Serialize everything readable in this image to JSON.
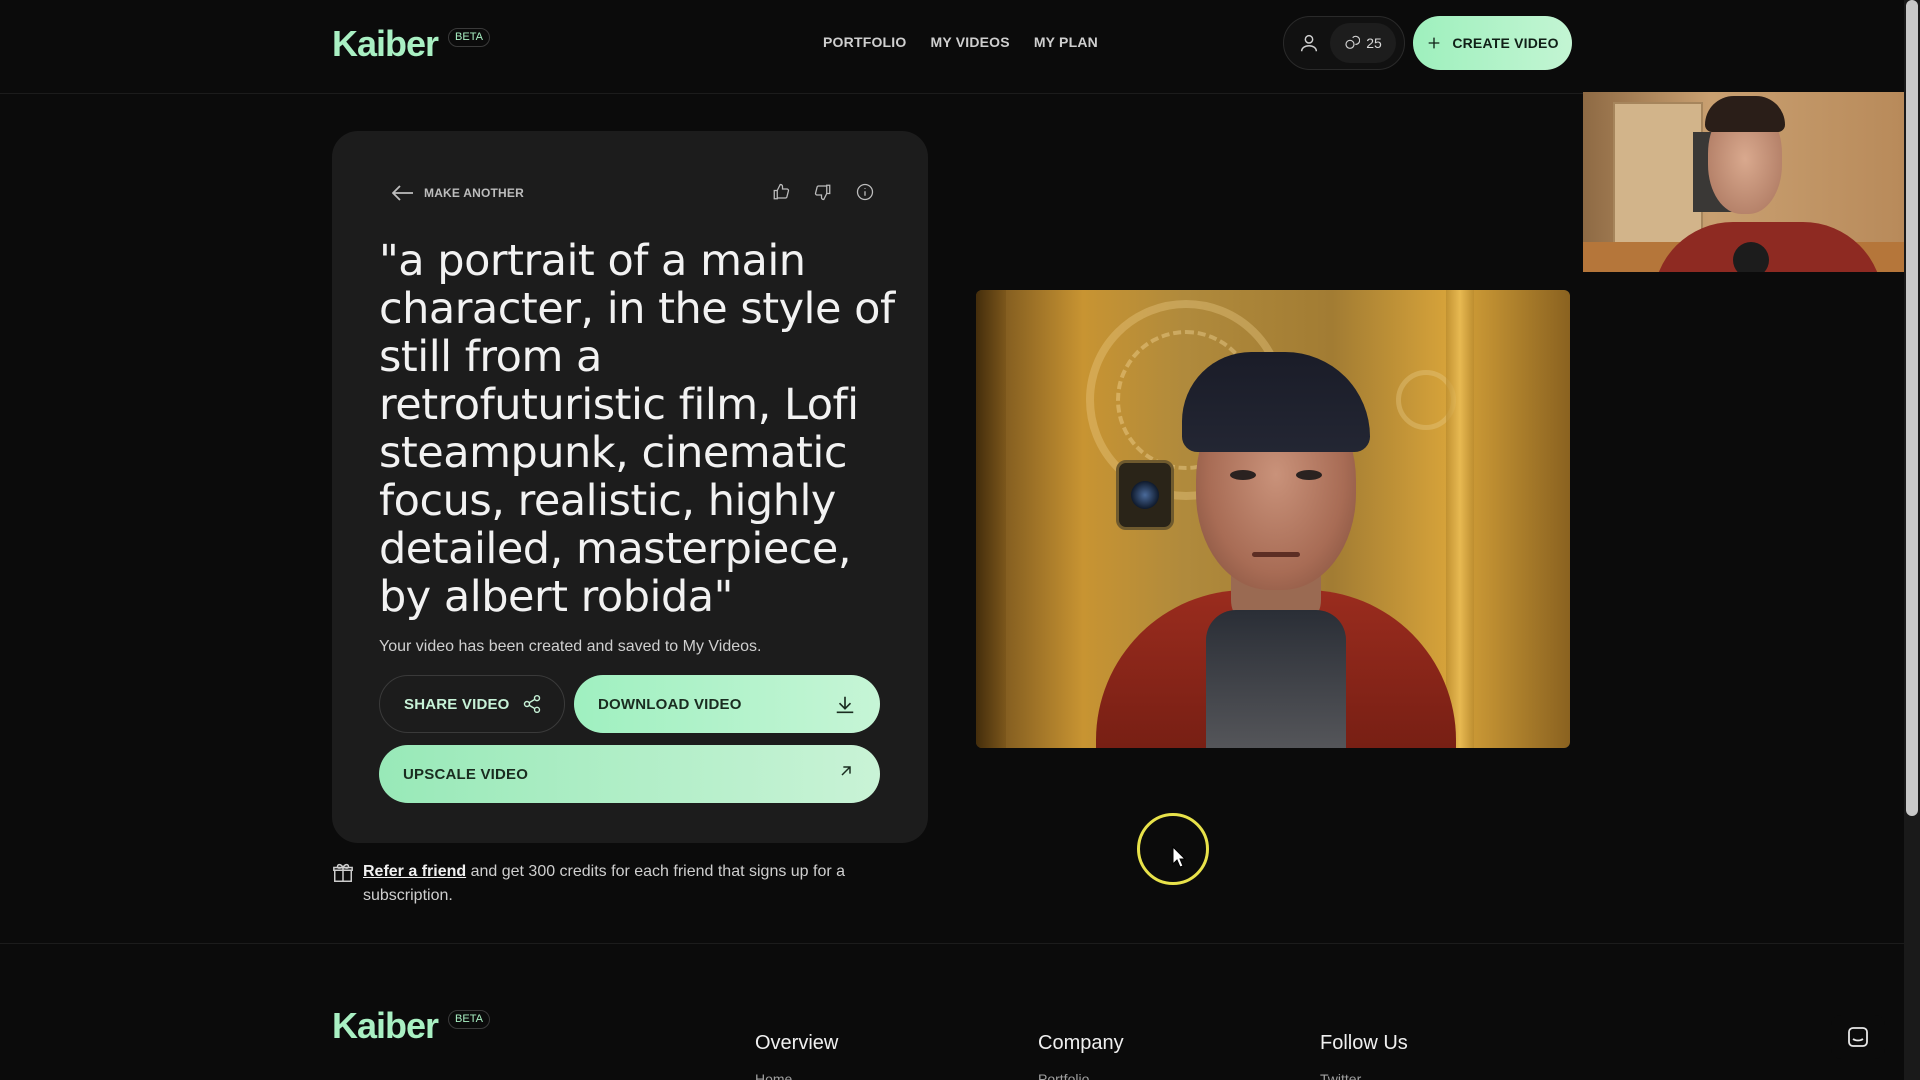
{
  "header": {
    "logo": "Kaiber",
    "beta": "BETA",
    "nav": [
      "PORTFOLIO",
      "MY VIDEOS",
      "MY PLAN"
    ],
    "credits": "25",
    "create_label": "CREATE VIDEO",
    "icons": {
      "user": "user-icon",
      "credits": "credits-icon",
      "plus": "plus-icon"
    }
  },
  "card": {
    "back_label": "MAKE ANOTHER",
    "prompt": "\"a portrait of a main character, in the style of still from a retrofuturistic film, Lofi steampunk, cinematic focus, realistic, highly detailed, masterpiece, by albert robida\"",
    "saved_message": "Your video has been created and saved to My Videos.",
    "share_label": "SHARE VIDEO",
    "download_label": "DOWNLOAD VIDEO",
    "upscale_label": "UPSCALE VIDEO"
  },
  "refer": {
    "link": "Refer a friend",
    "text": " and get 300 credits for each friend that signs up for a subscription."
  },
  "footer": {
    "logo": "Kaiber",
    "beta": "BETA",
    "columns": [
      {
        "title": "Overview",
        "first": "Home"
      },
      {
        "title": "Company",
        "first": "Portfolio"
      },
      {
        "title": "Follow Us",
        "first": "Twitter"
      }
    ]
  },
  "colors": {
    "accent": "#a9f0c3",
    "background": "#0b0b0b",
    "card": "#1c1c1c"
  }
}
